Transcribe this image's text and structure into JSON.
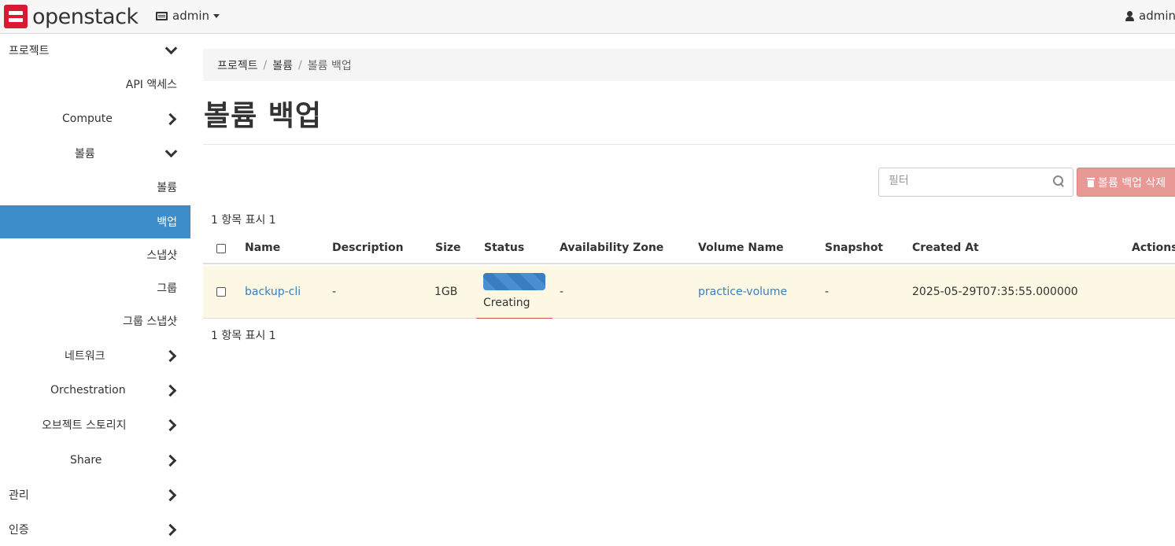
{
  "navbar": {
    "logo_text": "openstack",
    "project": "admin",
    "user": "admin"
  },
  "sidebar": {
    "items": [
      {
        "label": "프로젝트",
        "chevron": "down"
      },
      {
        "label": "API 액세스"
      },
      {
        "label": "Compute",
        "chevron": "right"
      },
      {
        "label": "볼륨",
        "chevron": "down"
      },
      {
        "label": "볼륨"
      },
      {
        "label": "백업",
        "active": true
      },
      {
        "label": "스냅샷"
      },
      {
        "label": "그룹"
      },
      {
        "label": "그룹 스냅샷"
      },
      {
        "label": "네트워크",
        "chevron": "right"
      },
      {
        "label": "Orchestration",
        "chevron": "right"
      },
      {
        "label": "오브젝트 스토리지",
        "chevron": "right"
      },
      {
        "label": "Share",
        "chevron": "right"
      },
      {
        "label": "관리",
        "chevron": "right"
      },
      {
        "label": "인증",
        "chevron": "right"
      }
    ]
  },
  "breadcrumb": [
    "프로젝트",
    "볼륨",
    "볼륨 백업"
  ],
  "page_title": "볼륨 백업",
  "filter": {
    "placeholder": "필터"
  },
  "delete_button": "볼륨 백업 삭제",
  "item_count_top": "1 항목 표시 1",
  "item_count_bottom": "1 항목 표시 1",
  "table": {
    "columns": [
      "Name",
      "Description",
      "Size",
      "Status",
      "Availability Zone",
      "Volume Name",
      "Snapshot",
      "Created At",
      "Actions"
    ],
    "rows": [
      {
        "name": "backup-cli",
        "description": "-",
        "size": "1GB",
        "status": "Creating",
        "availability_zone": "-",
        "volume_name": "practice-volume",
        "snapshot": "-",
        "created_at": "2025-05-29T07:35:55.000000"
      }
    ]
  },
  "colors": {
    "accent": "#3c8dc9",
    "danger_disabled": "#e89895",
    "row_highlight": "#fcf8e3",
    "link": "#3b7dbf",
    "logo_red": "#da1a32"
  }
}
